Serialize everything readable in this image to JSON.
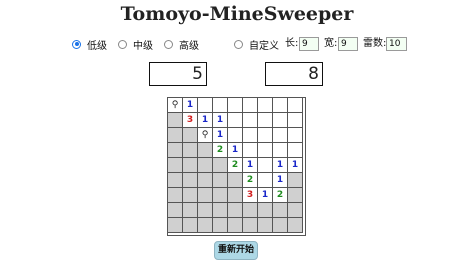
{
  "title": "Tomoyo-MineSweeper",
  "difficulty": {
    "options": [
      {
        "label": "低级",
        "checked": true
      },
      {
        "label": "中级",
        "checked": false
      },
      {
        "label": "高级",
        "checked": false
      },
      {
        "label": "自定义",
        "checked": false
      }
    ]
  },
  "custom": {
    "width_label": "长:",
    "width_value": "9",
    "height_label": "宽:",
    "height_value": "9",
    "mines_label": "雷数:",
    "mines_value": "10"
  },
  "counters": {
    "mines_left": "5",
    "timer": "8"
  },
  "board": {
    "rows": 9,
    "cols": 9,
    "grid": [
      [
        "F",
        "1",
        "",
        "",
        "",
        "",
        "",
        "",
        ""
      ],
      [
        "C",
        "3",
        "1",
        "1",
        "",
        "",
        "",
        "",
        ""
      ],
      [
        "C",
        "C",
        "F",
        "1",
        "",
        "",
        "",
        "",
        ""
      ],
      [
        "C",
        "C",
        "C",
        "2",
        "1",
        "",
        "",
        "",
        ""
      ],
      [
        "C",
        "C",
        "C",
        "C",
        "2",
        "1",
        "",
        "1",
        "1"
      ],
      [
        "C",
        "C",
        "C",
        "C",
        "C",
        "2",
        "",
        "1",
        "C"
      ],
      [
        "C",
        "C",
        "C",
        "C",
        "C",
        "3",
        "1",
        "2",
        "C"
      ],
      [
        "C",
        "C",
        "C",
        "C",
        "C",
        "C",
        "C",
        "C",
        "C"
      ],
      [
        "C",
        "C",
        "C",
        "C",
        "C",
        "C",
        "C",
        "C",
        "C"
      ]
    ],
    "flag_icon": "flag-icon"
  },
  "restart_label": "重新开始"
}
